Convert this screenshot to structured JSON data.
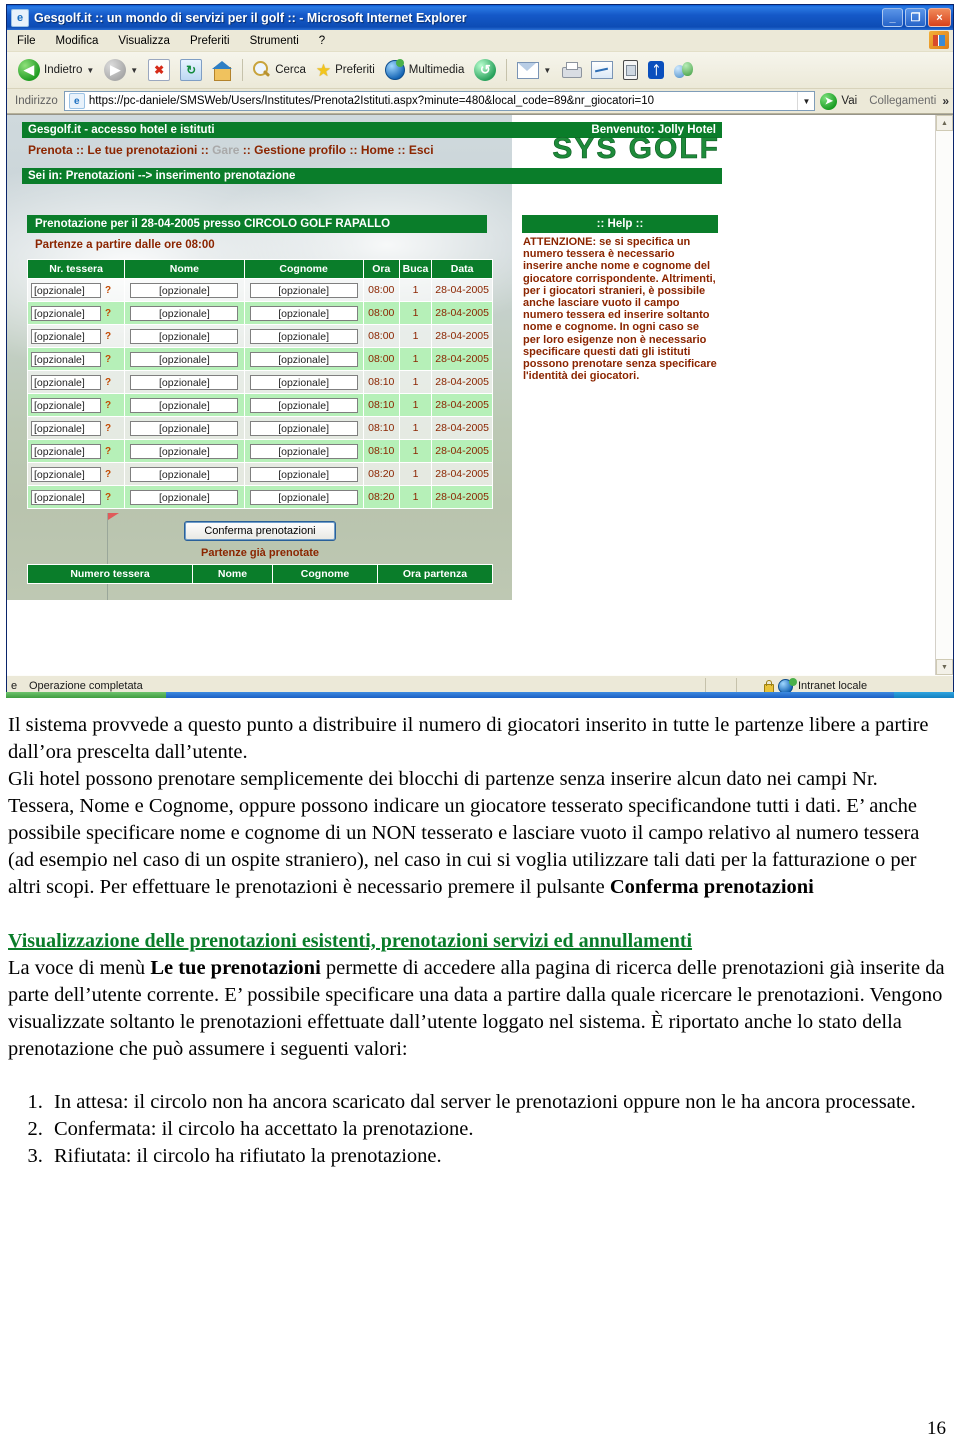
{
  "browser": {
    "title": "Gesgolf.it :: un mondo di servizi per il golf :: - Microsoft Internet Explorer",
    "window_buttons": {
      "minimize": "_",
      "maximize": "❐",
      "close": "×"
    },
    "menu": [
      "File",
      "Modifica",
      "Visualizza",
      "Preferiti",
      "Strumenti",
      "?"
    ],
    "toolbar": {
      "back": "Indietro",
      "forward": "",
      "stop": "",
      "refresh": "",
      "home": "",
      "search": "Cerca",
      "favorites": "Preferiti",
      "multimedia": "Multimedia",
      "history": ""
    },
    "address": {
      "label": "Indirizzo",
      "url": "https://pc-daniele/SMSWeb/Users/Institutes/Prenota2Istituti.aspx?minute=480&local_code=89&nr_giocatori=10",
      "go": "Vai",
      "links": "Collegamenti",
      "overflow": "»"
    },
    "status": {
      "message": "Operazione completata",
      "zone": "Intranet locale"
    }
  },
  "site": {
    "header_left": "Gesgolf.it - accesso hotel e istituti",
    "header_right": "Benvenuto: Jolly Hotel",
    "nav": [
      {
        "label": "Prenota",
        "disabled": false
      },
      {
        "label": "Le tue prenotazioni",
        "disabled": false
      },
      {
        "label": "Gare",
        "disabled": true
      },
      {
        "label": "Gestione profilo",
        "disabled": false
      },
      {
        "label": "Home",
        "disabled": false
      },
      {
        "label": "Esci",
        "disabled": false
      }
    ],
    "nav_separator": "::",
    "logo": "SYS GOLF",
    "breadcrumb": "Sei in: Prenotazioni --> inserimento prenotazione",
    "panel_title": "Prenotazione per il 28-04-2005 presso CIRCOLO GOLF RAPALLO",
    "panel_subtitle": "Partenze a partire dalle ore 08:00",
    "table": {
      "headers": [
        "Nr. tessera",
        "Nome",
        "Cognome",
        "Ora",
        "Buca",
        "Data"
      ],
      "placeholder": "[opzionale]",
      "help_marker": "?",
      "rows": [
        {
          "ora": "08:00",
          "buca": "1",
          "data": "28-04-2005"
        },
        {
          "ora": "08:00",
          "buca": "1",
          "data": "28-04-2005"
        },
        {
          "ora": "08:00",
          "buca": "1",
          "data": "28-04-2005"
        },
        {
          "ora": "08:00",
          "buca": "1",
          "data": "28-04-2005"
        },
        {
          "ora": "08:10",
          "buca": "1",
          "data": "28-04-2005"
        },
        {
          "ora": "08:10",
          "buca": "1",
          "data": "28-04-2005"
        },
        {
          "ora": "08:10",
          "buca": "1",
          "data": "28-04-2005"
        },
        {
          "ora": "08:10",
          "buca": "1",
          "data": "28-04-2005"
        },
        {
          "ora": "08:20",
          "buca": "1",
          "data": "28-04-2005"
        },
        {
          "ora": "08:20",
          "buca": "1",
          "data": "28-04-2005"
        }
      ]
    },
    "confirm_button": "Conferma prenotazioni",
    "already_booked_title": "Partenze già prenotate",
    "already_booked_headers": [
      "Numero tessera",
      "Nome",
      "Cognome",
      "Ora partenza"
    ],
    "help": {
      "title": ":: Help ::",
      "text": "ATTENZIONE: se si specifica un numero tessera è necessario inserire anche nome e cognome del giocatore corrispondente. Altrimenti, per i giocatori stranieri, è possibile anche lasciare vuoto il campo numero tessera ed inserire soltanto nome e cognome. In ogni caso se per loro esigenze non è necessario specificare questi dati gli istituti possono prenotare senza specificare l'identità dei giocatori."
    }
  },
  "document": {
    "para1": "Il sistema provvede a questo punto a distribuire il numero di giocatori inserito in tutte le partenze libere a partire dall’ora prescelta dall’utente.",
    "para2_a": "Gli hotel possono prenotare semplicemente dei blocchi di partenze senza inserire alcun dato nei campi Nr. Tessera, Nome e Cognome, oppure possono indicare un giocatore tesserato specificandone tutti i dati. E’ anche possibile specificare nome e cognome di un NON tesserato e lasciare vuoto il campo relativo al numero tessera (ad esempio nel caso di un ospite straniero), nel caso in cui si voglia utilizzare tali dati per la fatturazione o per altri scopi. Per effettuare le prenotazioni è necessario premere il pulsante ",
    "para2_b": "Conferma prenotazioni",
    "heading": "Visualizzazione delle prenotazioni esistenti, prenotazioni servizi ed annullamenti",
    "para3_a": "La voce di menù ",
    "para3_b": "Le tue prenotazioni",
    "para3_c": " permette di accedere alla pagina di ricerca delle prenotazioni già inserite da parte dell’utente corrente. E’ possibile specificare una data a partire dalla quale ricercare le prenotazioni. Vengono visualizzate soltanto le prenotazioni effettuate dall’utente loggato nel sistema. È riportato anche lo stato della prenotazione che può assumere i seguenti valori:",
    "list": [
      "In attesa: il circolo non ha ancora scaricato dal server le prenotazioni oppure non le ha ancora processate.",
      "Confermata: il circolo ha accettato la prenotazione.",
      "Rifiutata: il circolo ha rifiutato la prenotazione."
    ],
    "page_number": "16"
  }
}
